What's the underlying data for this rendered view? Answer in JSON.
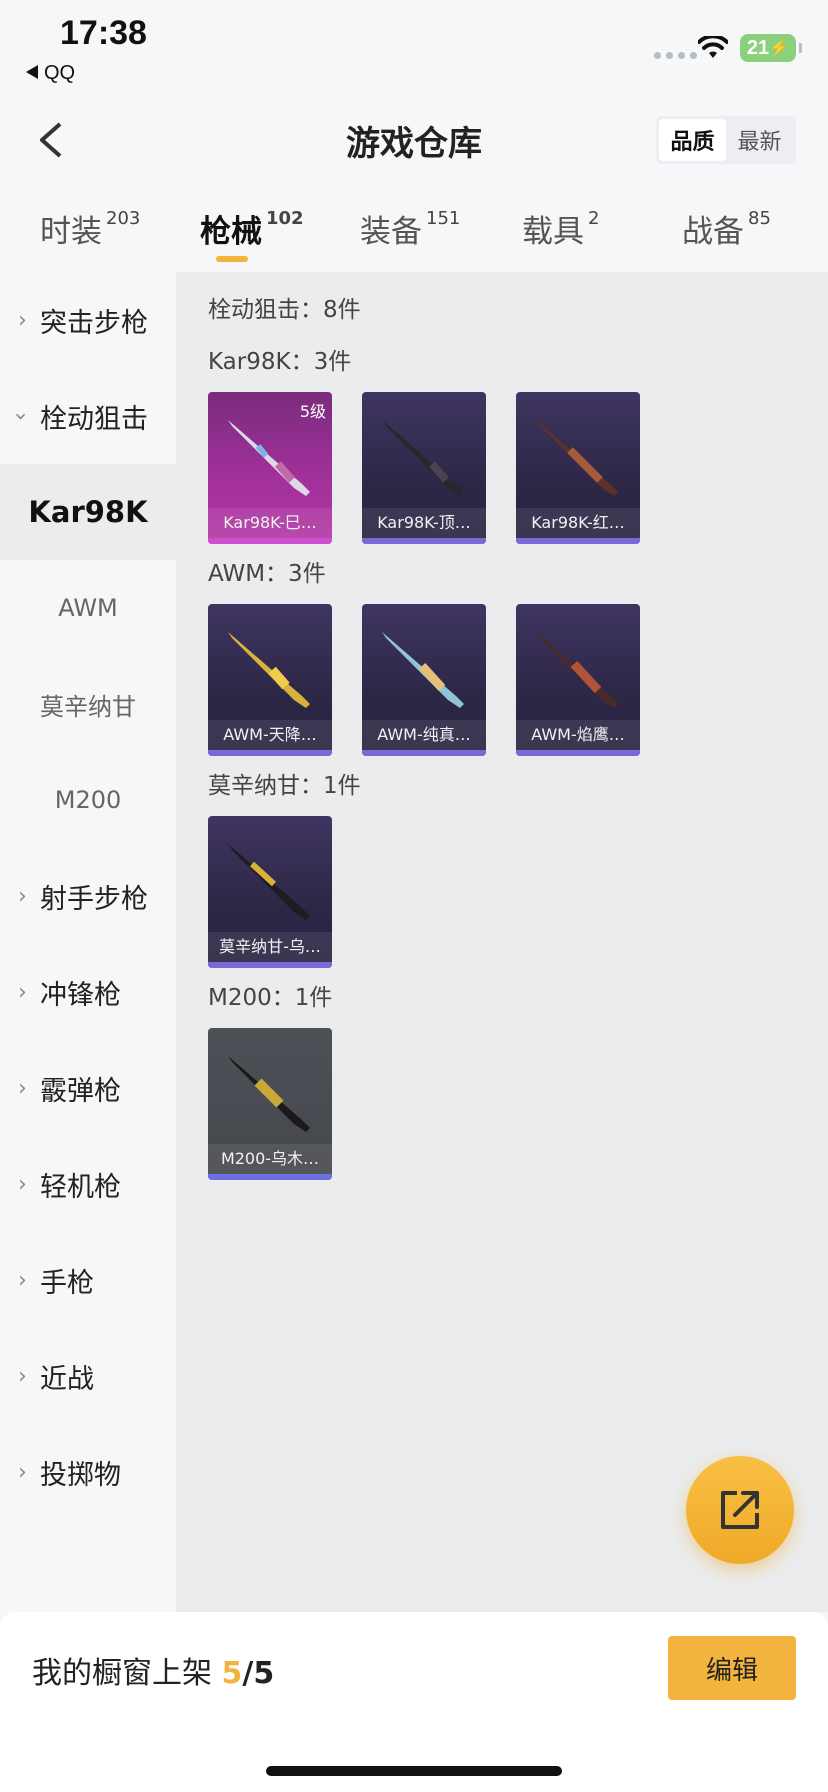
{
  "status_bar": {
    "time": "17:38",
    "back_app": "QQ",
    "battery": "21"
  },
  "header": {
    "title": "游戏仓库",
    "sort_options": [
      "品质",
      "最新"
    ]
  },
  "tabs": [
    {
      "label": "时装",
      "count": "203"
    },
    {
      "label": "枪械",
      "count": "102"
    },
    {
      "label": "装备",
      "count": "151"
    },
    {
      "label": "载具",
      "count": "2"
    },
    {
      "label": "战备",
      "count": "85"
    }
  ],
  "sidebar": {
    "items": [
      {
        "label": "突击步枪"
      },
      {
        "label": "栓动狙击"
      },
      {
        "label": "射手步枪"
      },
      {
        "label": "冲锋枪"
      },
      {
        "label": "霰弹枪"
      },
      {
        "label": "轻机枪"
      },
      {
        "label": "手枪"
      },
      {
        "label": "近战"
      },
      {
        "label": "投掷物"
      }
    ],
    "sub_items": [
      "Kar98K",
      "AWM",
      "莫辛纳甘",
      "M200"
    ]
  },
  "content": {
    "category_title": "栓动狙击：8件",
    "sections": [
      {
        "title": "Kar98K：3件",
        "items": [
          {
            "name": "Kar98K-巳…",
            "level": "5级"
          },
          {
            "name": "Kar98K-顶…"
          },
          {
            "name": "Kar98K-红…"
          }
        ]
      },
      {
        "title": "AWM：3件",
        "items": [
          {
            "name": "AWM-天降…"
          },
          {
            "name": "AWM-纯真…"
          },
          {
            "name": "AWM-焰鹰…"
          }
        ]
      },
      {
        "title": "莫辛纳甘：1件",
        "items": [
          {
            "name": "莫辛纳甘-乌…"
          }
        ]
      },
      {
        "title": "M200：1件",
        "items": [
          {
            "name": "M200-乌木…"
          }
        ]
      }
    ]
  },
  "bottom": {
    "label": "我的橱窗上架",
    "current": "5",
    "total": "/5",
    "edit": "编辑"
  },
  "colors": {
    "accent": "#f2b43c",
    "card_purple": "#2d2746",
    "card_pink": "#a0309a"
  }
}
